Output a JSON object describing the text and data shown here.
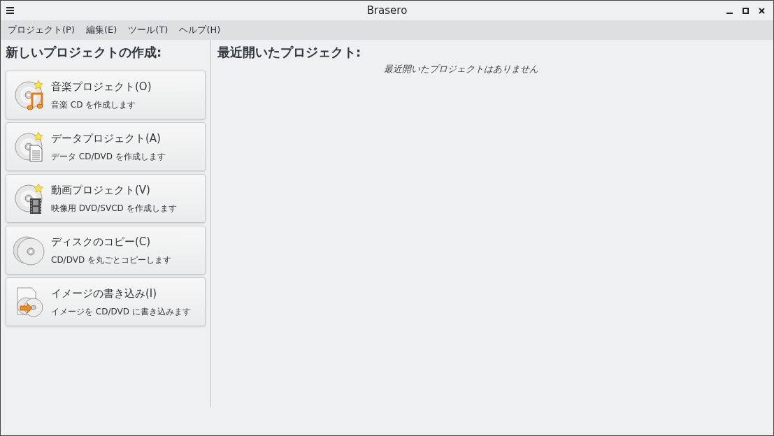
{
  "window": {
    "title": "Brasero"
  },
  "menu": [
    "プロジェクト(P)",
    "編集(E)",
    "ツール(T)",
    "ヘルプ(H)"
  ],
  "new_project": {
    "heading": "新しいプロジェクトの作成:",
    "items": [
      {
        "kind": "audio",
        "title": "音楽プロジェクト(O)",
        "subtitle": "音楽 CD を作成します"
      },
      {
        "kind": "data",
        "title": "データプロジェクト(A)",
        "subtitle": "データ CD/DVD を作成します"
      },
      {
        "kind": "video",
        "title": "動画プロジェクト(V)",
        "subtitle": "映像用 DVD/SVCD を作成します"
      },
      {
        "kind": "copy",
        "title": "ディスクのコピー(C)",
        "subtitle": "CD/DVD を丸ごとコピーします"
      },
      {
        "kind": "image",
        "title": "イメージの書き込み(I)",
        "subtitle": "イメージを CD/DVD に書き込みます"
      }
    ]
  },
  "recent_projects": {
    "heading": "最近開いたプロジェクト:",
    "empty_message": "最近開いたプロジェクトはありません"
  }
}
